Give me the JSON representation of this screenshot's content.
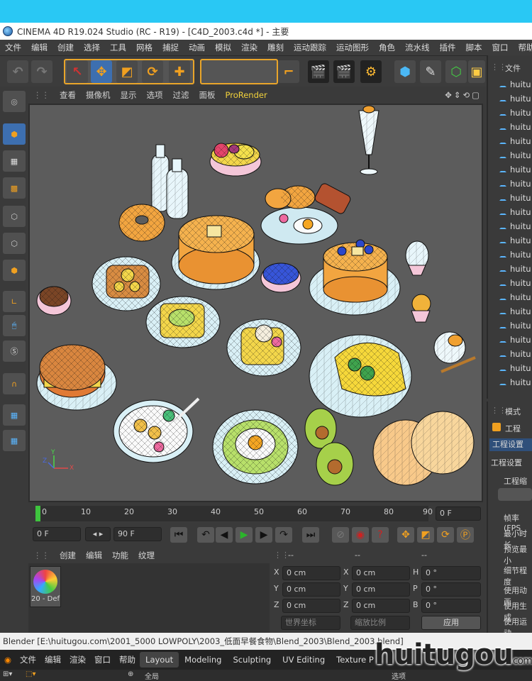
{
  "window": {
    "title": "CINEMA 4D R19.024 Studio (RC - R19) - [C4D_2003.c4d *] - 主要"
  },
  "menu": [
    "文件",
    "编辑",
    "创建",
    "选择",
    "工具",
    "网格",
    "捕捉",
    "动画",
    "模拟",
    "渲染",
    "雕刻",
    "运动跟踪",
    "运动图形",
    "角色",
    "流水线",
    "插件",
    "脚本",
    "窗口",
    "帮助"
  ],
  "viewport_menu": {
    "items": [
      "查看",
      "摄像机",
      "显示",
      "选项",
      "过滤",
      "面板"
    ],
    "renderer": "ProRender"
  },
  "toolbar": {
    "axis_x": "X",
    "axis_y": "Y",
    "axis_z": "Z"
  },
  "timeline": {
    "ticks": [
      "0",
      "10",
      "20",
      "30",
      "40",
      "50",
      "60",
      "70",
      "80",
      "90"
    ],
    "current_frame": "0 F"
  },
  "playback": {
    "start": "0 F",
    "end": "90 F"
  },
  "material_panel": {
    "tabs": [
      "创建",
      "编辑",
      "功能",
      "纹理"
    ],
    "material_name": "20 - Def"
  },
  "coords": {
    "headers": [
      "--",
      "--",
      "--"
    ],
    "rows": [
      {
        "a": "X",
        "av": "0 cm",
        "b": "X",
        "bv": "0 cm",
        "c": "H",
        "cv": "0 °"
      },
      {
        "a": "Y",
        "av": "0 cm",
        "b": "Y",
        "bv": "0 cm",
        "c": "P",
        "cv": "0 °"
      },
      {
        "a": "Z",
        "av": "0 cm",
        "b": "Z",
        "bv": "0 cm",
        "c": "B",
        "cv": "0 °"
      }
    ],
    "world": "世界坐标",
    "scale": "缩放比例",
    "apply": "应用"
  },
  "object_manager": {
    "tab": "文件",
    "items": [
      "huitu",
      "huitu",
      "huitu",
      "huitu",
      "huitu",
      "huitu",
      "huitu",
      "huitu",
      "huitu",
      "huitu",
      "huitu",
      "huitu",
      "huitu",
      "huitu",
      "huitu",
      "huitu",
      "huitu",
      "huitu",
      "huitu",
      "huitu",
      "huitu",
      "huitu"
    ]
  },
  "attributes": {
    "tab": "模式",
    "project": "工程",
    "project_settings_tab": "工程设置",
    "section": "工程设置",
    "scale_label": "工程缩放",
    "fps": "帧率(FPS",
    "min_length": "最小时长",
    "preview_min": "预览最小",
    "detail": "细节程度",
    "use_anim": "使用动画",
    "use_gen": "使用生成",
    "use_deform": "使用运动"
  },
  "statusbar": {
    "text": "Blender [E:\\huitugou.com\\2001_5000 LOWPOLY\\2003_低面早餐食物\\Blend_2003\\Blend_2003.blend]"
  },
  "blender_menu": [
    "文件",
    "编辑",
    "渲染",
    "窗口",
    "帮助"
  ],
  "blender_workspaces": [
    "Layout",
    "Modeling",
    "Sculpting",
    "UV Editing",
    "Texture P"
  ],
  "blender_row2": {
    "mode": "全局",
    "select": "选项"
  },
  "watermark": "huitugou",
  "watermark_suffix": "com"
}
